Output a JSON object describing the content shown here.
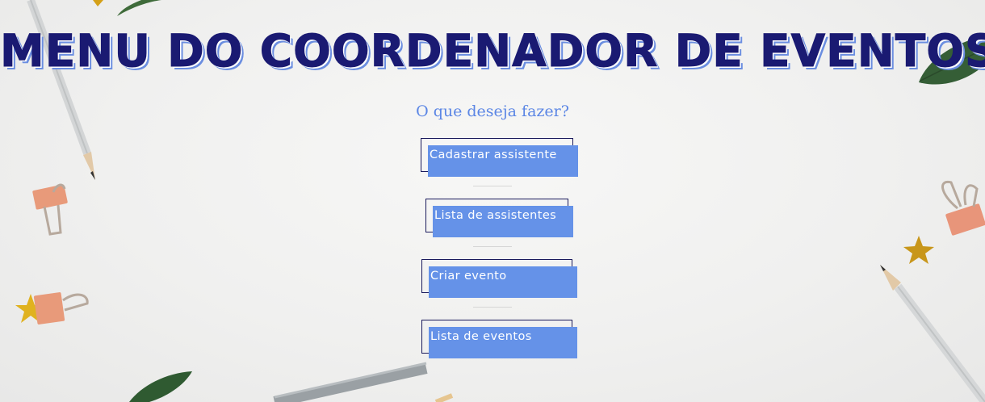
{
  "page": {
    "title": "MENU DO COORDENADOR DE EVENTOS",
    "subtitle": "O que deseja fazer?"
  },
  "menu": {
    "items": [
      {
        "label": "Cadastrar assistente"
      },
      {
        "label": "Lista de assistentes"
      },
      {
        "label": "Criar evento"
      },
      {
        "label": "Lista de eventos"
      }
    ]
  },
  "colors": {
    "title": "#1a1a72",
    "title_shadow": "#6b8ee0",
    "subtitle": "#5b86e5",
    "button_fill": "#6592e8",
    "button_border": "#1a1a5c",
    "button_text": "#ffffff"
  },
  "icons": [
    "pencil-icon",
    "leaf-icon",
    "star-icon",
    "binder-clip-icon"
  ]
}
